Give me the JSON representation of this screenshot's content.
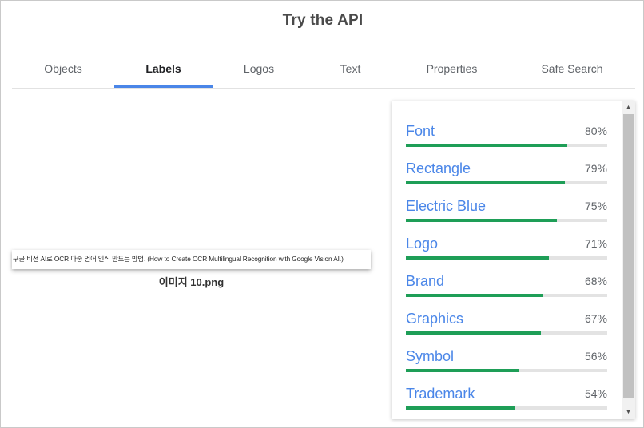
{
  "title": "Try the API",
  "tabs": [
    {
      "label": "Objects"
    },
    {
      "label": "Labels"
    },
    {
      "label": "Logos"
    },
    {
      "label": "Text"
    },
    {
      "label": "Properties"
    },
    {
      "label": "Safe Search"
    }
  ],
  "active_tab": "Labels",
  "image": {
    "thumbnail_text": "구글 비전 AI로 OCR 다중 언어 인식 만드는 방법. (How to Create OCR Multilingual Recognition with Google Vision AI.)",
    "filename": "이미지 10.png"
  },
  "labels": [
    {
      "name": "Font",
      "percent_text": "80%",
      "score": 0.8
    },
    {
      "name": "Rectangle",
      "percent_text": "79%",
      "score": 0.79
    },
    {
      "name": "Electric Blue",
      "percent_text": "75%",
      "score": 0.75
    },
    {
      "name": "Logo",
      "percent_text": "71%",
      "score": 0.71
    },
    {
      "name": "Brand",
      "percent_text": "68%",
      "score": 0.68
    },
    {
      "name": "Graphics",
      "percent_text": "67%",
      "score": 0.67
    },
    {
      "name": "Symbol",
      "percent_text": "56%",
      "score": 0.56
    },
    {
      "name": "Trademark",
      "percent_text": "54%",
      "score": 0.54
    }
  ],
  "colors": {
    "accent": "#4a86e8",
    "bar": "#1e9e57",
    "track": "#e3e3e3"
  },
  "icons": {
    "scroll_up": "scroll-up-arrow-icon",
    "scroll_down": "scroll-down-arrow-icon"
  }
}
